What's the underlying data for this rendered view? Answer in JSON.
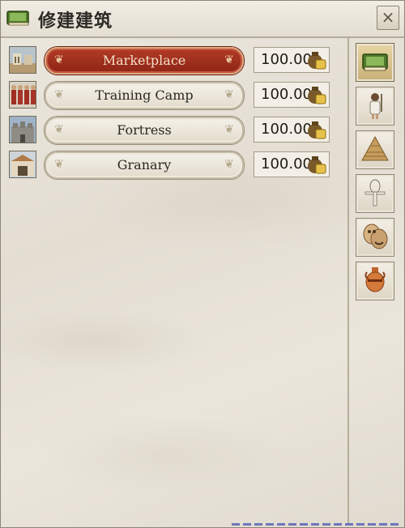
{
  "window": {
    "title": "修建建筑",
    "title_icon": "green-book-icon",
    "close_label": "×"
  },
  "buildings": [
    {
      "name": "Marketplace",
      "cost": "100.00",
      "thumb": "marketplace-icon",
      "selected": true
    },
    {
      "name": "Training Camp",
      "cost": "100.00",
      "thumb": "soldiers-icon",
      "selected": false
    },
    {
      "name": "Fortress",
      "cost": "100.00",
      "thumb": "fortress-icon",
      "selected": false
    },
    {
      "name": "Granary",
      "cost": "100.00",
      "thumb": "granary-icon",
      "selected": false
    }
  ],
  "categories": [
    {
      "name": "economy-category",
      "icon": "green-book-icon",
      "active": true
    },
    {
      "name": "military-category",
      "icon": "soldier-icon",
      "active": false
    },
    {
      "name": "monument-category",
      "icon": "pyramid-icon",
      "active": false
    },
    {
      "name": "religion-category",
      "icon": "ankh-icon",
      "active": false
    },
    {
      "name": "culture-category",
      "icon": "theater-masks-icon",
      "active": false
    },
    {
      "name": "trade-category",
      "icon": "amphora-icon",
      "active": false
    }
  ],
  "colors": {
    "selected_button": "#9e2d1c",
    "panel_bg": "#e6e0d5",
    "active_category": "#d8c48e"
  }
}
